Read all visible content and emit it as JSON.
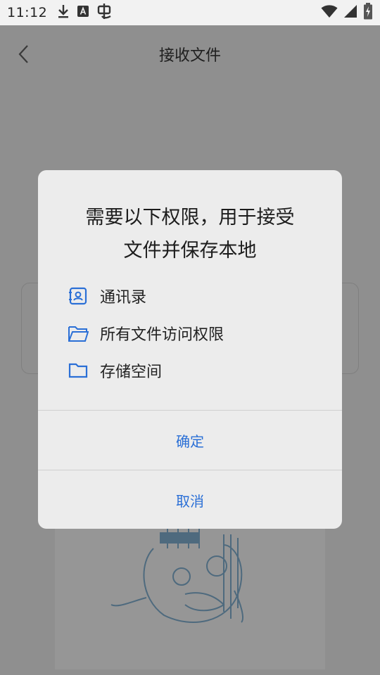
{
  "status_bar": {
    "time": "11:12",
    "icons_left": [
      "download-icon",
      "translate-icon",
      "app-icon"
    ],
    "icons_right": [
      "wifi-icon",
      "signal-icon",
      "battery-charging-icon"
    ]
  },
  "app_bar": {
    "title": "接收文件",
    "back_icon": "chevron-left-icon"
  },
  "dialog": {
    "heading_line1": "需要以下权限，用于接受",
    "heading_line2": "文件并保存本地",
    "permissions": [
      {
        "label": "通讯录",
        "icon": "contacts-icon"
      },
      {
        "label": "所有文件访问权限",
        "icon": "folder-open-icon"
      },
      {
        "label": "存储空间",
        "icon": "folder-icon"
      }
    ],
    "confirm_label": "确定",
    "cancel_label": "取消"
  },
  "colors": {
    "accent": "#2a6fd6",
    "scrim": "#8f8f8f",
    "dialog_bg": "#ececec",
    "status_bar_bg": "#f2f2f2"
  }
}
